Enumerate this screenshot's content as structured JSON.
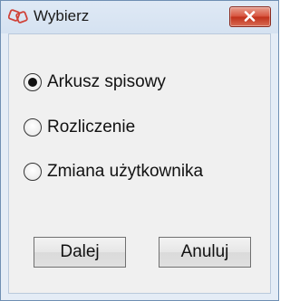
{
  "window": {
    "title": "Wybierz",
    "app_icon": "two-ring-logo-icon",
    "close_icon": "close-x-icon",
    "close_color": "#c0301a"
  },
  "options": [
    {
      "label": "Arkusz spisowy",
      "checked": true
    },
    {
      "label": "Rozliczenie",
      "checked": false
    },
    {
      "label": "Zmiana użytkownika",
      "checked": false
    }
  ],
  "buttons": {
    "next_label": "Dalej",
    "cancel_label": "Anuluj"
  }
}
